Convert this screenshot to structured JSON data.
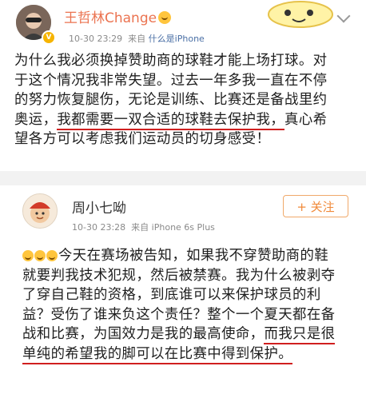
{
  "post1": {
    "user_name": "王哲林Change",
    "timestamp": "10-30 23:29",
    "source_prefix": "来自",
    "source_device": "什么是iPhone",
    "lines": {
      "l1": "为什么我必须换掉赞助商的球鞋才能上场打球。对",
      "l2": "于这个情况我非常失望。过去一年多我一直在不停",
      "l3": "的努力恢复腿伤，无论是训练、比赛还是备战里约",
      "l4_a": "奥运，",
      "l4_hl": "我都需要一双合适的球鞋去保护我，",
      "l4_b": "真心希",
      "l5": "望各方可以考虑我们运动员的切身感受！"
    }
  },
  "post2": {
    "user_name": "周小七呦",
    "timestamp": "10-30 23:28",
    "source_prefix": "来自",
    "source_device": "iPhone 6s Plus",
    "follow_label": "+ 关注",
    "lines": {
      "l1": "今天在赛场被告知，如果我不穿赞助商的鞋",
      "l2": "就要判我技术犯规，然后被禁赛。我为什么被剥夺",
      "l3": "了穿自己鞋的资格，到底谁可以来保护球员的利",
      "l4": "益？受伤了谁来负这个责任？整个一个夏天都在备",
      "l5_a": "战和比赛，为国效力是我的最高使命，",
      "l5_hl": "而我只是很",
      "l6_hl": "单纯的希望我的脚可以在比赛中得到保护。"
    }
  },
  "colors": {
    "name_orange": "#eb7350",
    "highlight_underline": "#d01f1f",
    "follow_orange": "#f08a3a",
    "link_blue": "#4a6fa5"
  },
  "icons": [
    "avatar",
    "verified-badge",
    "emoji-badge",
    "more-chevron-icon",
    "sticker",
    "laughing-emoji"
  ]
}
